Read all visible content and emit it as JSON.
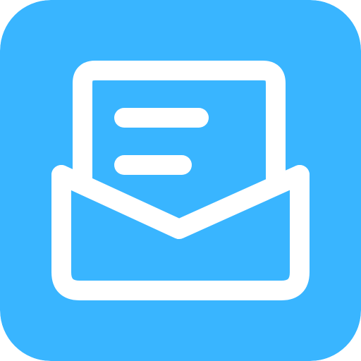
{
  "icon": {
    "name": "open-envelope-letter-icon",
    "colors": {
      "background": "#39b5ff",
      "stroke": "#ffffff"
    }
  }
}
